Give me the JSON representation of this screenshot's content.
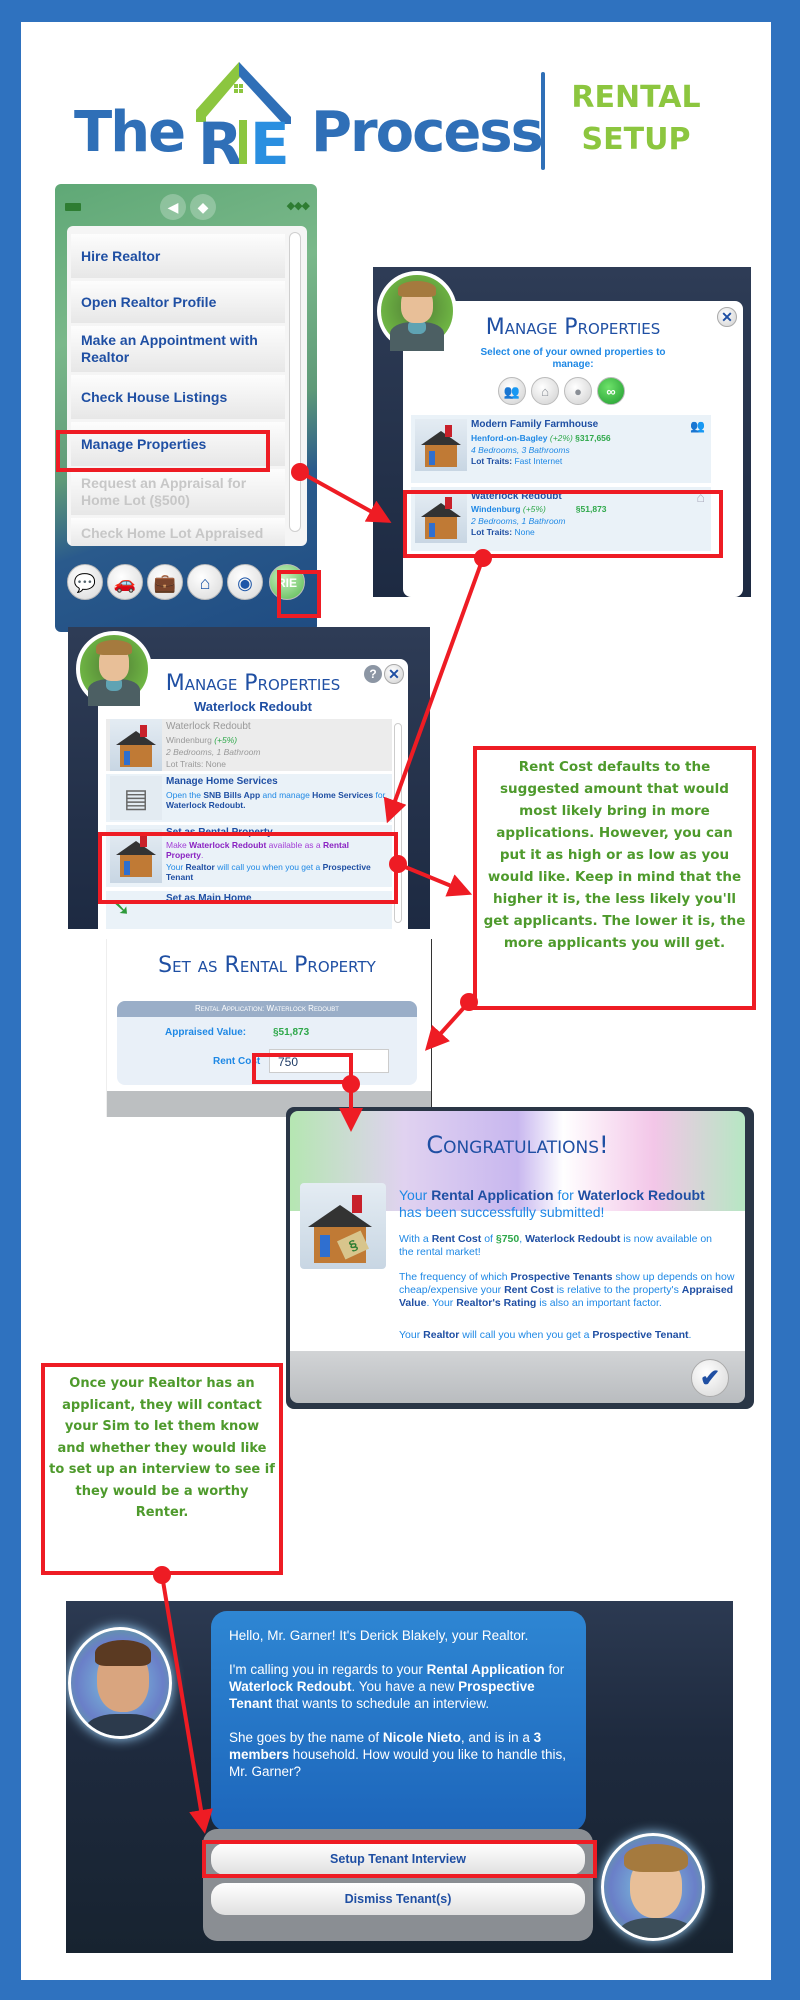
{
  "header": {
    "logo_left": "The",
    "logo_mark": "RIE",
    "logo_right": "Process",
    "subtitle_line1": "RENTAL",
    "subtitle_line2": "SETUP"
  },
  "colors": {
    "frame_blue": "#2f72bf",
    "brand_blue": "#2f6fb7",
    "brand_green": "#8cc63f",
    "highlight_red": "#ee1c24",
    "note_green": "#4e9a2c"
  },
  "phone_menu": {
    "status_icons": [
      "battery-icon",
      "speaker-icon",
      "tag-icon",
      "signal-icon"
    ],
    "items": [
      {
        "label": "Hire Realtor",
        "enabled": true
      },
      {
        "label": "Open Realtor Profile",
        "enabled": true
      },
      {
        "label": "Make an Appointment with Realtor",
        "enabled": true
      },
      {
        "label": "Check House Listings",
        "enabled": true
      },
      {
        "label": "Manage Properties",
        "enabled": true,
        "highlighted": true
      },
      {
        "label": "Request an Appraisal for Home Lot (§500)",
        "enabled": false
      },
      {
        "label": "Check Home Lot Appraised",
        "enabled": false
      }
    ],
    "dock": [
      {
        "icon": "chat-icon",
        "glyph": "💬"
      },
      {
        "icon": "car-icon",
        "glyph": "🚗"
      },
      {
        "icon": "briefcase-icon",
        "glyph": "💼"
      },
      {
        "icon": "home-icon",
        "glyph": "⌂"
      },
      {
        "icon": "speaker-icon",
        "glyph": "◉"
      },
      {
        "icon": "rie-app-icon",
        "glyph": "RIE",
        "highlighted": true
      }
    ]
  },
  "manage_properties_list": {
    "title": "Manage Properties",
    "subtitle": "Select one of your owned properties to manage:",
    "filters": [
      "household-filter",
      "home-filter",
      "piggybank-filter",
      "all-filter"
    ],
    "properties": [
      {
        "name": "Modern Family Farmhouse",
        "world": "Henford-on-Bagley",
        "change": "(+2%)",
        "value": "§317,656",
        "rooms": "4 Bedrooms, 3 Bathrooms",
        "lot_traits_label": "Lot Traits:",
        "lot_traits": "Fast Internet",
        "status_icon": "household-icon"
      },
      {
        "name": "Waterlock Redoubt",
        "world": "Windenburg",
        "change": "(+5%)",
        "value": "§51,873",
        "rooms": "2 Bedrooms, 1 Bathroom",
        "lot_traits_label": "Lot Traits:",
        "lot_traits": "None",
        "status_icon": "home-outline-icon",
        "highlighted": true
      }
    ]
  },
  "manage_property_detail": {
    "title": "Manage Properties",
    "subtitle": "Waterlock Redoubt",
    "current": {
      "name": "Waterlock Redoubt",
      "world": "Windenburg",
      "change": "(+5%)",
      "rooms": "2 Bedrooms, 1 Bathroom",
      "lot_traits": "Lot Traits: None"
    },
    "options": [
      {
        "title": "Manage Home Services",
        "desc_pre": "Open the ",
        "desc_b1": "SNB Bills App",
        "desc_mid": " and manage ",
        "desc_b2": "Home Services",
        "desc_post": " for",
        "desc_b3": "Waterlock Redoubt."
      },
      {
        "title": "Set as Rental Property",
        "desc1_pre": "Make ",
        "desc1_b1": "Waterlock Redoubt",
        "desc1_mid": " available as a ",
        "desc1_b2": "Rental Property",
        "desc1_post": ".",
        "desc2_pre": "Your ",
        "desc2_b1": "Realtor",
        "desc2_mid": " will call you when you get a ",
        "desc2_b2": "Prospective Tenant",
        "highlighted": true
      },
      {
        "title": "Set as Main Home"
      }
    ]
  },
  "note_rent_cost": "Rent Cost defaults to the suggested amount that would most likely bring in more applications. However, you can put it as high or as low as you would like. Keep in mind that the higher it is, the less likely you'll get applicants. The lower it is, the more applicants you will get.",
  "set_rental": {
    "title": "Set as Rental Property",
    "section_header": "Rental Application: Waterlock Redoubt",
    "appraised_label": "Appraised Value:",
    "appraised_value": "§51,873",
    "rent_label": "Rent Cost",
    "rent_value": "750"
  },
  "congrats": {
    "title": "Congratulations!",
    "headline_pre": "Your ",
    "headline_b1": "Rental Application",
    "headline_mid": " for ",
    "headline_b2": "Waterlock Redoubt",
    "headline_post": " has been successfully submitted!",
    "p1_pre": "With a ",
    "p1_b1": "Rent Cost",
    "p1_mid": " of ",
    "p1_money": "§750",
    "p1_sep": ", ",
    "p1_b2": "Waterlock Redoubt",
    "p1_post": " is now available on the rental market!",
    "p2_a": "The frequency of which ",
    "p2_b1": "Prospective Tenants",
    "p2_c": " show up depends on how cheap/expensive your ",
    "p2_b2": "Rent Cost",
    "p2_d": " is relative to the property's ",
    "p2_b3": "Appraised Value",
    "p2_e": ". Your ",
    "p2_b4": "Realtor's Rating",
    "p2_f": " is also an important factor.",
    "p3_a": "Your ",
    "p3_b1": "Realtor",
    "p3_c": " will call you when you get a ",
    "p3_b2": "Prospective Tenant",
    "p3_d": ".",
    "ok_icon": "checkmark-icon"
  },
  "note_applicant": "Once your Realtor has an applicant, they will contact your Sim to let them know and whether they would like to set up an interview to see if they would be a worthy Renter.",
  "phone_call": {
    "p1": "Hello, Mr. Garner! It's Derick Blakely, your Realtor.",
    "p2_a": "I'm calling you in regards to your ",
    "p2_b1": "Rental Application",
    "p2_c": " for ",
    "p2_b2": "Waterlock Redoubt",
    "p2_d": ". You have a new ",
    "p2_b3": "Prospective Tenant",
    "p2_e": " that wants to schedule an interview.",
    "p3_a": "She goes by the name of ",
    "p3_b1": "Nicole Nieto",
    "p3_c": ", and is in a ",
    "p3_b2": "3 members",
    "p3_d": " household. How would you like to handle this, Mr. Garner?",
    "choices": [
      {
        "label": "Setup Tenant Interview",
        "highlighted": true
      },
      {
        "label": "Dismiss Tenant(s)"
      }
    ]
  }
}
